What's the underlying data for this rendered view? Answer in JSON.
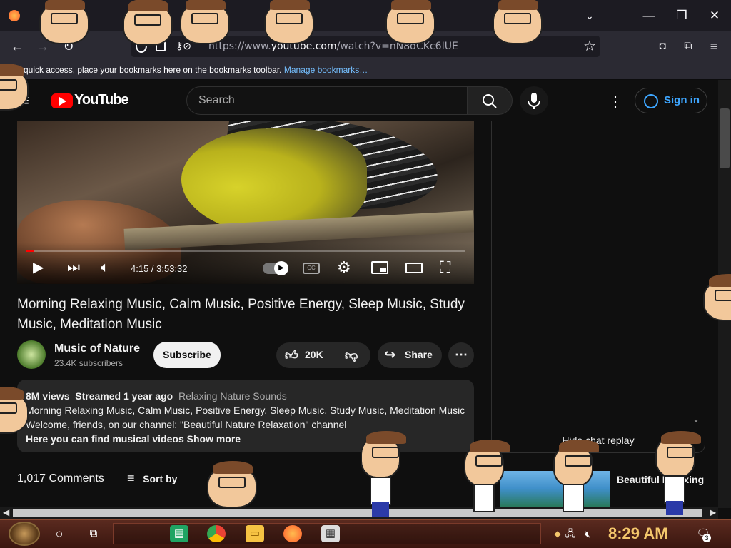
{
  "browser": {
    "url_prefix": "https://www.",
    "url_domain": "youtube.com",
    "url_path": "/watch?v=nN8dCKc6IUE",
    "bookmarks_text": "quick access, place your bookmarks here on the bookmarks toolbar.",
    "bookmarks_link": "Manage bookmarks…"
  },
  "youtube": {
    "logo_text": "YouTube",
    "search_placeholder": "Search",
    "sign_in": "Sign in"
  },
  "video": {
    "time": "4:15 / 3:53:32",
    "progress": 0.018,
    "title": "Morning Relaxing Music, Calm Music, Positive Energy, Sleep Music, Study Music, Meditation Music",
    "cc_label": "CC"
  },
  "channel": {
    "name": "Music of Nature",
    "subscribers": "23.4K subscribers",
    "subscribe_label": "Subscribe",
    "likes": "20K",
    "share_label": "Share"
  },
  "description": {
    "views": "8M views",
    "streamed": "Streamed 1 year ago",
    "tag": "Relaxing Nature Sounds",
    "line1": "Morning Relaxing Music, Calm Music, Positive Energy, Sleep Music, Study Music, Meditation Music",
    "line2": "Welcome, friends, on our channel: \"Beautiful Nature Relaxation\" channel",
    "line3": "Here you can find musical videos",
    "show_more": "Show more"
  },
  "comments": {
    "count": "1,017 Comments",
    "sort_by": "Sort by"
  },
  "chat": {
    "replay_label": "Hide chat replay"
  },
  "suggestion": {
    "title": "Beautiful Relaxing"
  },
  "taskbar": {
    "clock": "8:29 AM",
    "notification_count": "3"
  },
  "colors": {
    "youtube_red": "#ff0000",
    "link_blue": "#3ea6ff",
    "clock_gold": "#f3c66b"
  }
}
